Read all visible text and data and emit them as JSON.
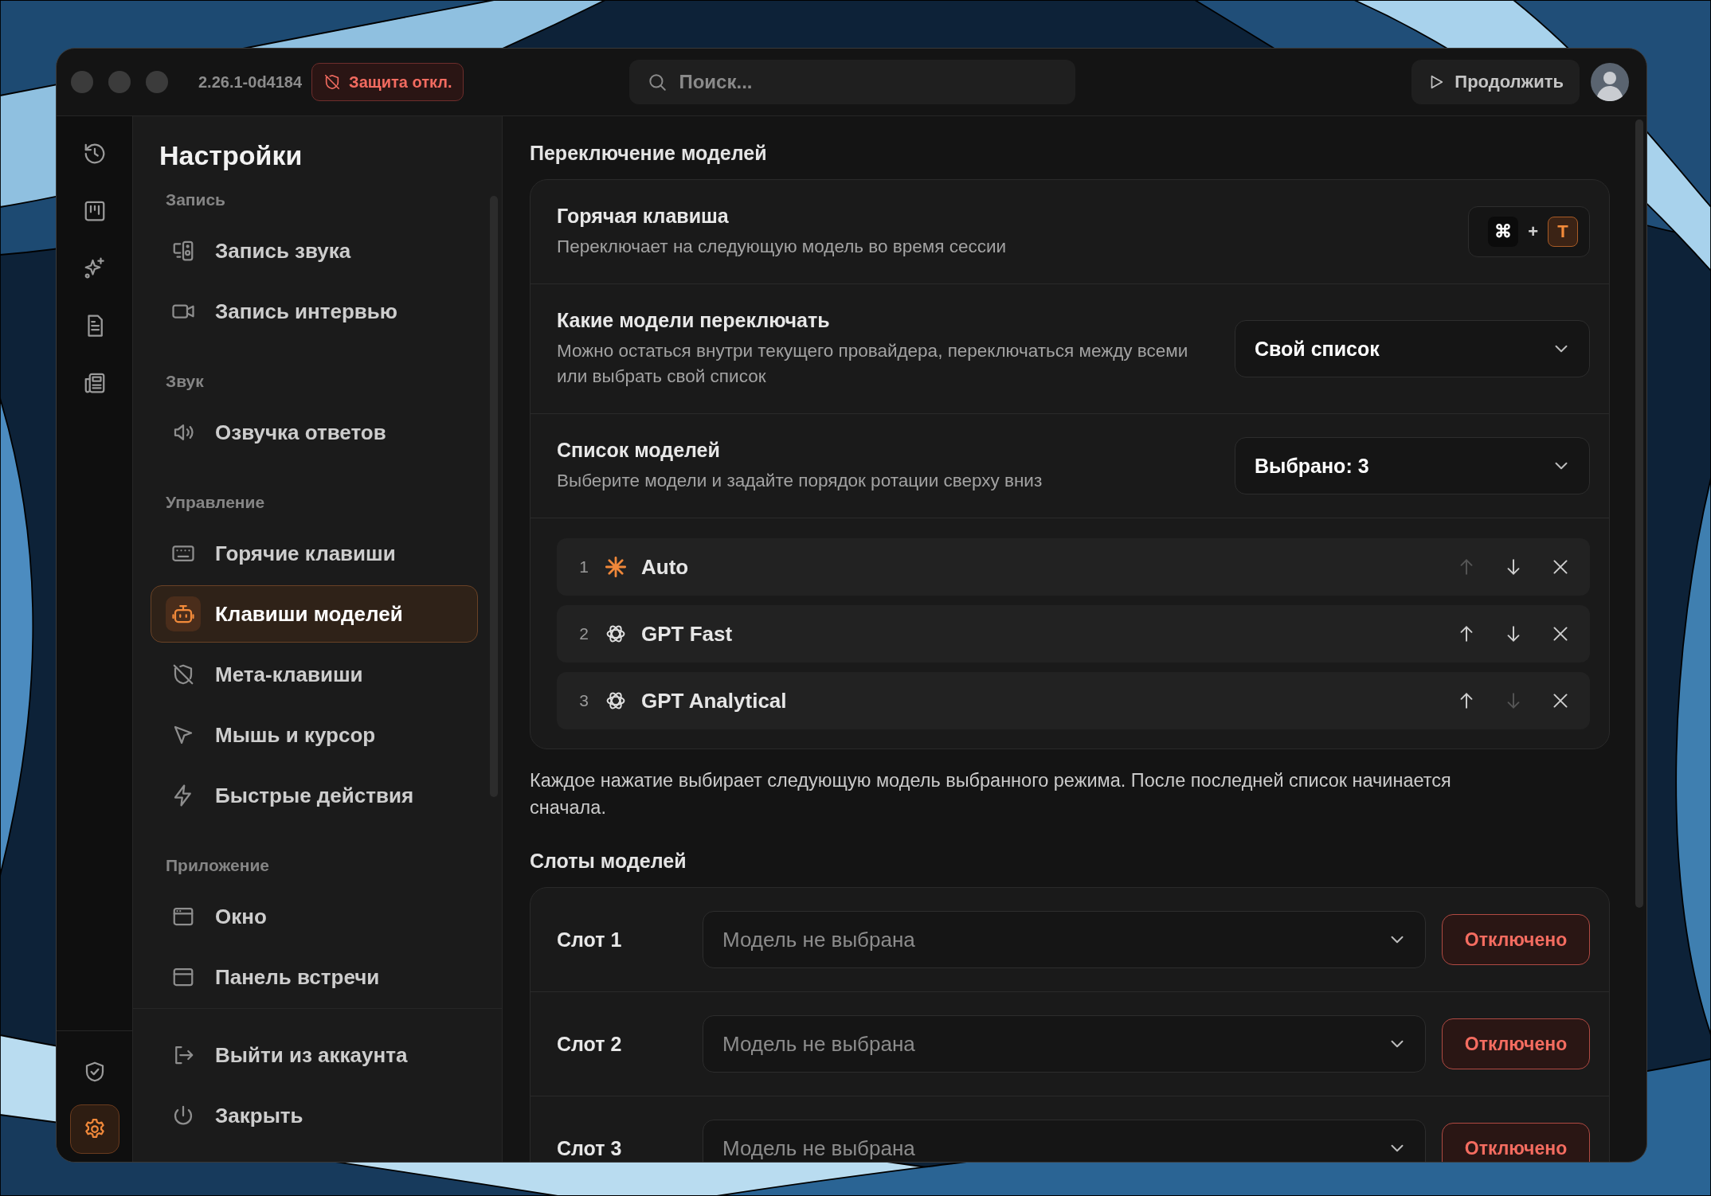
{
  "titlebar": {
    "version": "2.26.1-0d4184",
    "protection_badge": "Защита откл.",
    "search": {
      "placeholder": "Поиск..."
    },
    "continue_button": "Продолжить"
  },
  "rail": {
    "items": [
      {
        "selected": false
      },
      {
        "selected": false
      },
      {
        "selected": false
      },
      {
        "selected": false
      },
      {
        "selected": false
      }
    ],
    "bottom_items": [
      {
        "selected": false
      },
      {
        "selected": true
      }
    ]
  },
  "sidebar": {
    "title": "Настройки",
    "sections": [
      {
        "label": "Запись",
        "items": [
          {
            "label": "Запись звука",
            "selected": false
          },
          {
            "label": "Запись интервью",
            "selected": false
          }
        ]
      },
      {
        "label": "Звук",
        "items": [
          {
            "label": "Озвучка ответов",
            "selected": false
          }
        ]
      },
      {
        "label": "Управление",
        "items": [
          {
            "label": "Горячие клавиши",
            "selected": false
          },
          {
            "label": "Клавиши моделей",
            "selected": true
          },
          {
            "label": "Мета-клавиши",
            "selected": false
          },
          {
            "label": "Мышь и курсор",
            "selected": false
          },
          {
            "label": "Быстрые действия",
            "selected": false
          }
        ]
      },
      {
        "label": "Приложение",
        "items": [
          {
            "label": "Окно",
            "selected": false
          },
          {
            "label": "Панель встречи",
            "selected": false
          }
        ]
      }
    ],
    "footer_items": [
      {
        "label": "Выйти из аккаунта"
      },
      {
        "label": "Закрыть"
      }
    ]
  },
  "content": {
    "switching": {
      "title": "Переключение моделей",
      "hotkey": {
        "title": "Горячая клавиша",
        "description": "Переключает на следующую модель во время сессии",
        "keys": [
          {
            "label": "⌘",
            "highlighted": false
          },
          {
            "label": "T",
            "highlighted": true
          }
        ],
        "separator": "+"
      },
      "which_models": {
        "title": "Какие модели переключать",
        "description": "Можно остаться внутри текущего провайдера, переключаться между всеми или выбрать свой список",
        "value": "Свой список"
      },
      "model_list": {
        "title": "Список моделей",
        "description": "Выберите модели и задайте порядок ротации сверху вниз",
        "value": "Выбрано: 3",
        "items": [
          {
            "number": "1",
            "name": "Auto",
            "kind": "auto",
            "up_disabled": true,
            "down_disabled": false
          },
          {
            "number": "2",
            "name": "GPT Fast",
            "kind": "standard",
            "up_disabled": false,
            "down_disabled": false
          },
          {
            "number": "3",
            "name": "GPT Analytical",
            "kind": "standard",
            "up_disabled": false,
            "down_disabled": true
          }
        ]
      }
    },
    "note": "Каждое нажатие выбирает следующую модель выбранного режима. После последней список начинается сначала.",
    "slots": {
      "title": "Слоты моделей",
      "items": [
        {
          "label": "Слот 1",
          "placeholder": "Модель не выбрана",
          "status": "Отключено",
          "enabled": false
        },
        {
          "label": "Слот 2",
          "placeholder": "Модель не выбрана",
          "status": "Отключено",
          "enabled": false
        },
        {
          "label": "Слот 3",
          "placeholder": "Модель не выбрана",
          "status": "Отключено",
          "enabled": false
        }
      ]
    }
  }
}
